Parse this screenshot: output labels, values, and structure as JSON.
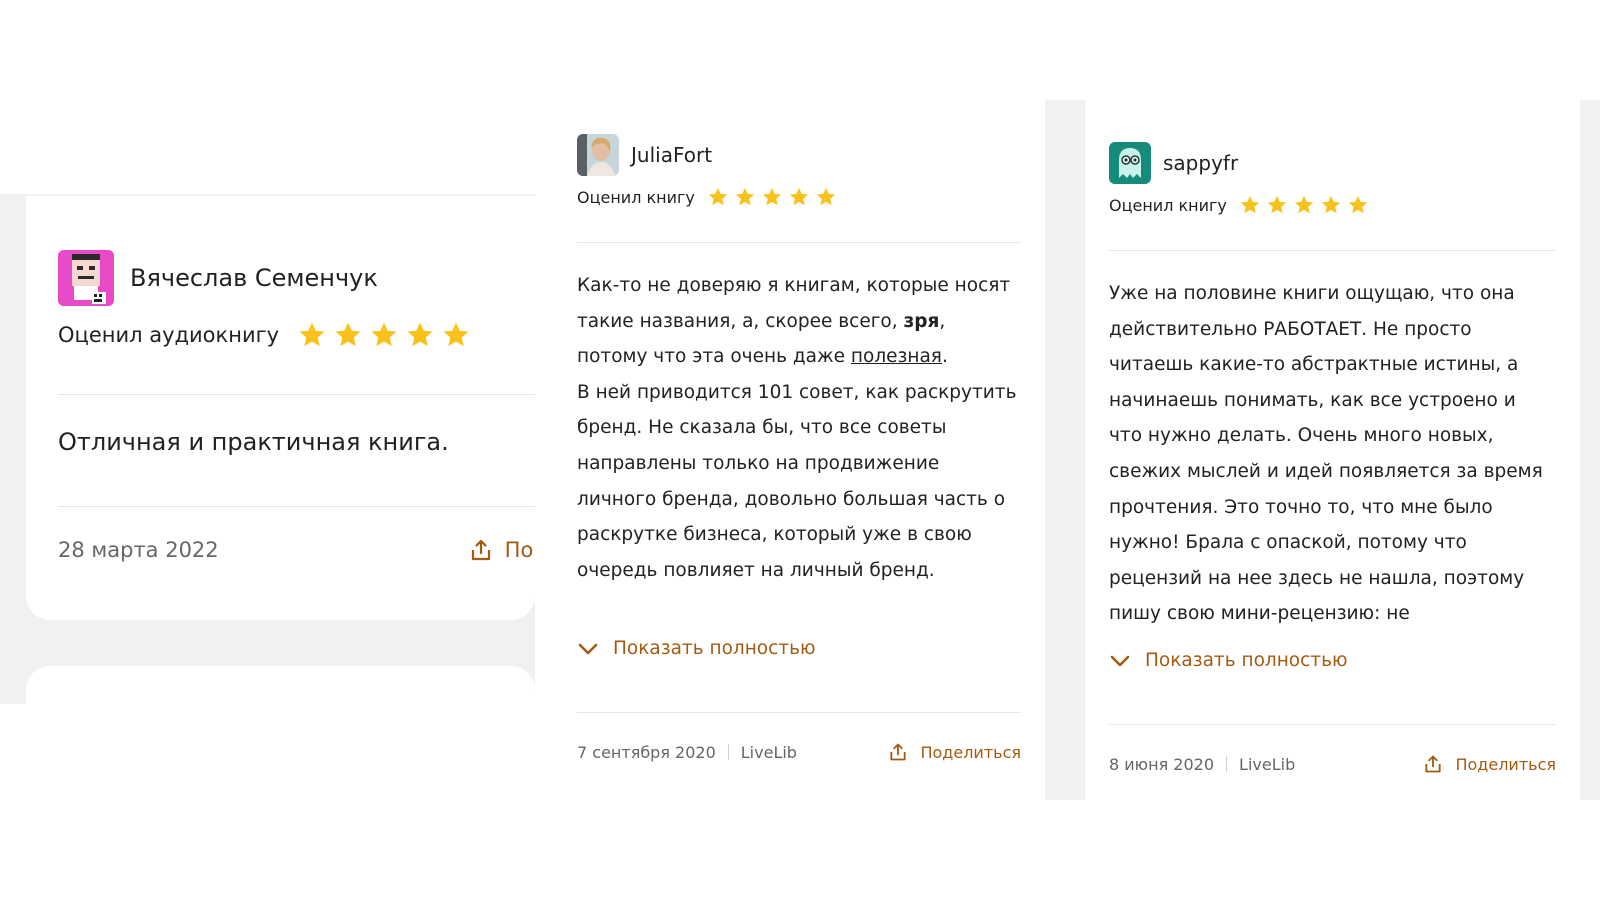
{
  "card1": {
    "username": "Вячеслав Семенчук",
    "rating_label": "Оценил аудиокнигу",
    "stars": 5,
    "review": "Отличная и практичная книга.",
    "date": "28 марта 2022",
    "share_label": "По"
  },
  "card2": {
    "username": "JuliaFort",
    "rating_label": "Оценил книгу",
    "stars": 5,
    "review": {
      "p1_a": "Как-то не доверяю я книгам, которые носят такие названия, а, скорее всего, ",
      "p1_bold": "зря",
      "p1_b": ", потому что эта очень даже ",
      "p1_link": "полезная",
      "p1_c": ".",
      "p2": "В ней приводится 101 совет, как раскрутить бренд. Не сказала бы, что все советы направлены только на продвижение личного бренда, довольно большая часть о раскрутке бизнеса, который уже в свою очередь повлияет на личный бренд."
    },
    "show_more": "Показать полностью",
    "date": "7 сентября 2020",
    "source": "LiveLib",
    "share_label": "Поделиться"
  },
  "card3": {
    "username": "sappyfr",
    "rating_label": "Оценил книгу",
    "stars": 5,
    "review": "Уже на половине книги ощущаю, что она действительно РАБОТАЕТ. Не просто читаешь какие-то абстрактные истины, а начинаешь понимать, как все устроено и что нужно делать. Очень много новых, свежих мыслей и идей появляется за время прочтения. Это точно то, что мне было нужно! Брала с опаской, потому что рецензий на нее здесь не нашла, поэтому пишу свою мини-рецензию: не",
    "show_more": "Показать полностью",
    "date": "8 июня 2020",
    "source": "LiveLib",
    "share_label": "Поделиться"
  },
  "colors": {
    "star": "#f8c11b",
    "accent": "#a55a12",
    "background_strip": "#f1f1f1"
  },
  "icons": [
    "avatar-image",
    "star-icon",
    "chevron-down-icon",
    "share-icon"
  ]
}
